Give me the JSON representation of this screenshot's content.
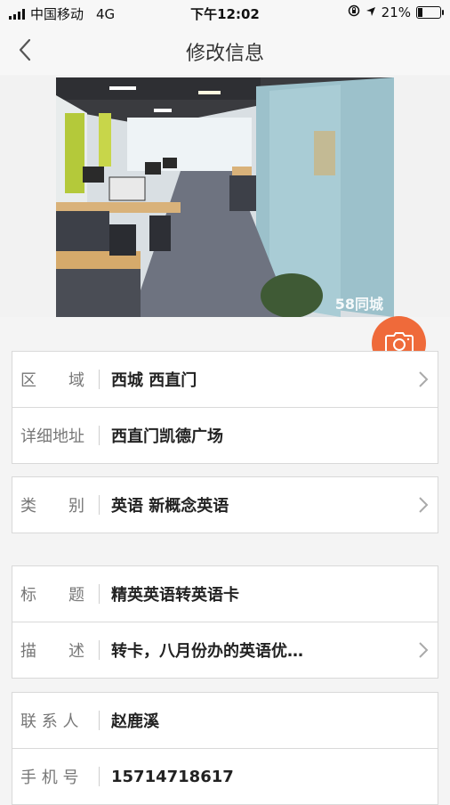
{
  "status": {
    "carrier": "中国移动",
    "network": "4G",
    "time": "下午12:02",
    "battery": "21%",
    "battery_level": 0.21
  },
  "nav": {
    "title": "修改信息"
  },
  "photo": {
    "watermark": "58同城"
  },
  "fields": {
    "region": {
      "label": "区　　域",
      "value": "西城 西直门"
    },
    "address": {
      "label": "详细地址",
      "value": "西直门凯德广场"
    },
    "category": {
      "label": "类　　别",
      "value": "英语 新概念英语"
    },
    "title": {
      "label": "标　　题",
      "value": "精英英语转英语卡"
    },
    "description": {
      "label": "描　　述",
      "value": "转卡，八月份办的英语优…"
    },
    "contact": {
      "label": "联 系 人",
      "value": "赵鹿溪"
    },
    "phone": {
      "label": "手 机 号",
      "value": "15714718617"
    }
  },
  "colors": {
    "accent": "#ef6a3a"
  }
}
